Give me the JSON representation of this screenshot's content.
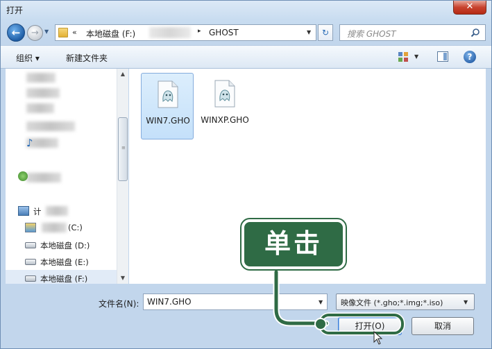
{
  "window": {
    "title": "打开",
    "close_glyph": "✕"
  },
  "nav": {
    "back_glyph": "←",
    "forward_glyph": "→",
    "history_glyph": "▼"
  },
  "address": {
    "chevron": "«",
    "segment1": "本地磁盘 (F:)",
    "separator": "▸",
    "segment2": "GHOST",
    "dropdown_glyph": "▼"
  },
  "refresh_glyph": "↻",
  "search": {
    "placeholder": "搜索 GHOST"
  },
  "toolbar": {
    "organize_label": "组织 ▾",
    "new_folder_label": "新建文件夹",
    "help_glyph": "?",
    "view_drop_glyph": "▼"
  },
  "sidebar": {
    "items": [
      {
        "label": "计",
        "icon": "computer-icon"
      },
      {
        "label": "(C:)",
        "icon": "drive-c-icon"
      },
      {
        "label": "本地磁盘 (D:)",
        "icon": "drive-icon"
      },
      {
        "label": "本地磁盘 (E:)",
        "icon": "drive-icon"
      },
      {
        "label": "本地磁盘 (F:)",
        "icon": "drive-icon"
      }
    ],
    "scroll_up": "▲",
    "scroll_down": "▼",
    "grip": "≡"
  },
  "files": [
    {
      "name": "WIN7.GHO",
      "selected": true
    },
    {
      "name": "WINXP.GHO",
      "selected": false
    }
  ],
  "footer": {
    "filename_label": "文件名(N):",
    "filename_value": "WIN7.GHO",
    "filetype_value": "映像文件 (*.gho;*.img;*.iso)",
    "dropdown_glyph": "▼",
    "open_button": "打开(O)",
    "cancel_button": "取消"
  },
  "annotation": {
    "text": "单击",
    "color": "#2f6b45"
  },
  "colors": {
    "accent": "#3d7bd6",
    "window_frame": "#c2d6ec",
    "close": "#c8432f"
  }
}
